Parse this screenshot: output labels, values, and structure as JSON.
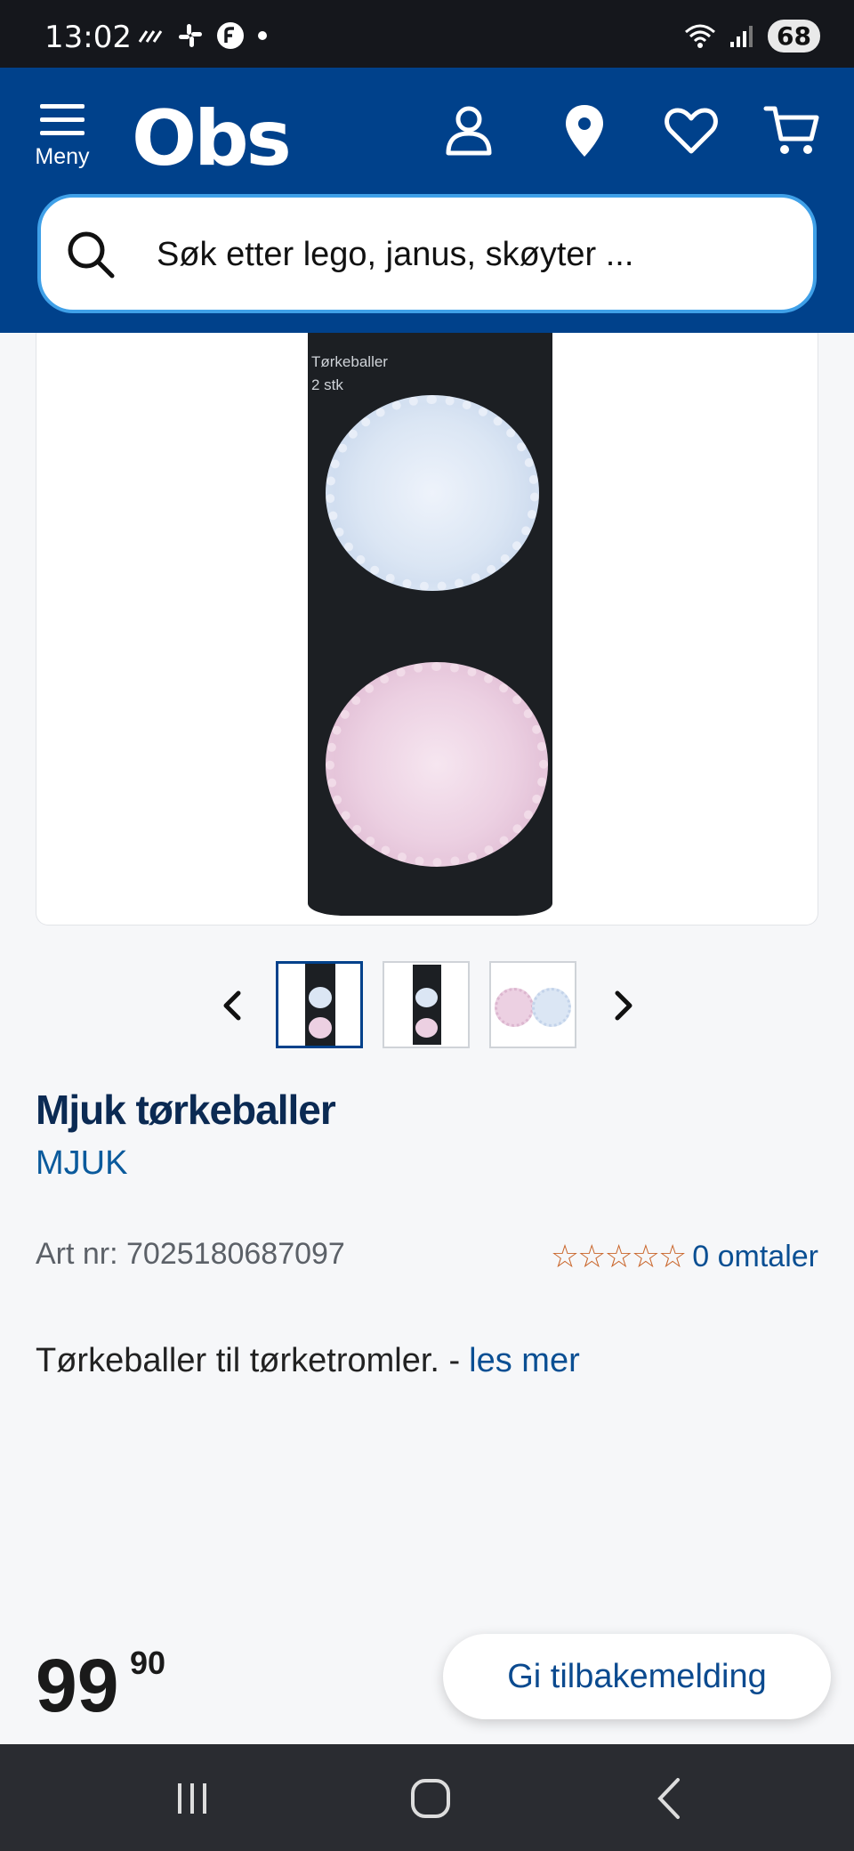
{
  "status_bar": {
    "time": "13:02",
    "battery": "68"
  },
  "header": {
    "menu_label": "Meny",
    "logo": "Obs",
    "icons": [
      "account-icon",
      "location-pin-icon",
      "heart-icon",
      "cart-icon"
    ]
  },
  "search": {
    "placeholder": "Søk etter lego, janus, skøyter ..."
  },
  "product_image": {
    "package_label_line1": "Tørkeballer",
    "package_label_line2": "2 stk"
  },
  "gallery": {
    "thumbnail_count": 3,
    "active_index": 0
  },
  "product": {
    "title": "Mjuk tørkeballer",
    "brand": "MJUK",
    "article": "Art nr: 7025180687097",
    "stars": "☆☆☆☆☆",
    "reviews": "0 omtaler",
    "description": "Tørkeballer til tørketromler. -",
    "read_more": "les mer"
  },
  "price": {
    "whole": "99",
    "decimal": "90"
  },
  "feedback_button": "Gi tilbakemelding",
  "colors": {
    "brand_blue": "#00418b",
    "search_border": "#3fa0e8",
    "title_navy": "#0b2a53",
    "link_blue": "#0a4f93",
    "star_orange": "#c9652a"
  }
}
